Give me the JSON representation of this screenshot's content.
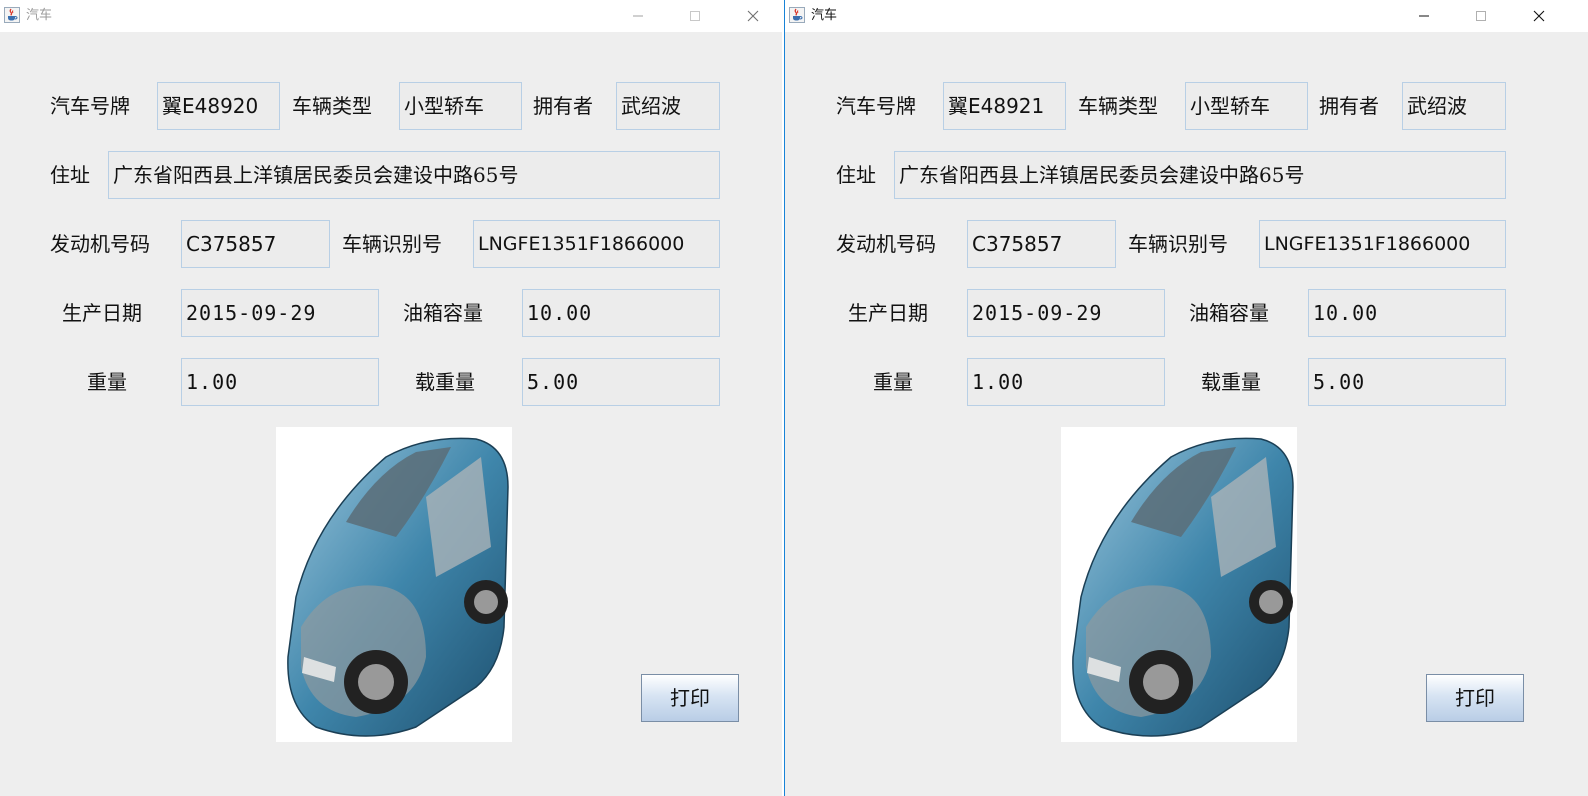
{
  "windows": [
    {
      "title": "汽车",
      "fields": {
        "plate_label": "汽车号牌",
        "plate_value": "翼E48920",
        "type_label": "车辆类型",
        "type_value": "小型轿车",
        "owner_label": "拥有者",
        "owner_value": "武绍波",
        "address_label": "住址",
        "address_value": "广东省阳西县上洋镇居民委员会建设中路65号",
        "engine_label": "发动机号码",
        "engine_value": "C375857",
        "vin_label": "车辆识别号",
        "vin_value": "LNGFE1351F1866000",
        "date_label": "生产日期",
        "date_value": "2015-09-29",
        "tank_label": "油箱容量",
        "tank_value": "10.00",
        "weight_label": "重量",
        "weight_value": "1.00",
        "load_label": "载重量",
        "load_value": "5.00"
      },
      "print_label": "打印"
    },
    {
      "title": "汽车",
      "fields": {
        "plate_label": "汽车号牌",
        "plate_value": "翼E48921",
        "type_label": "车辆类型",
        "type_value": "小型轿车",
        "owner_label": "拥有者",
        "owner_value": "武绍波",
        "address_label": "住址",
        "address_value": "广东省阳西县上洋镇居民委员会建设中路65号",
        "engine_label": "发动机号码",
        "engine_value": "C375857",
        "vin_label": "车辆识别号",
        "vin_value": "LNGFE1351F1866000",
        "date_label": "生产日期",
        "date_value": "2015-09-29",
        "tank_label": "油箱容量",
        "tank_value": "10.00",
        "weight_label": "重量",
        "weight_value": "1.00",
        "load_label": "载重量",
        "load_value": "5.00"
      },
      "print_label": "打印"
    }
  ],
  "icons": {
    "app": "java-cup-icon",
    "minimize": "minimize-icon",
    "maximize": "maximize-icon",
    "close": "close-icon",
    "car_image": "car-cutaway-image"
  },
  "colors": {
    "window_bg": "#eeeeee",
    "field_border": "#b8cfe5",
    "active_border": "#1883d7",
    "button_gradient_bottom": "#b9cde6"
  }
}
